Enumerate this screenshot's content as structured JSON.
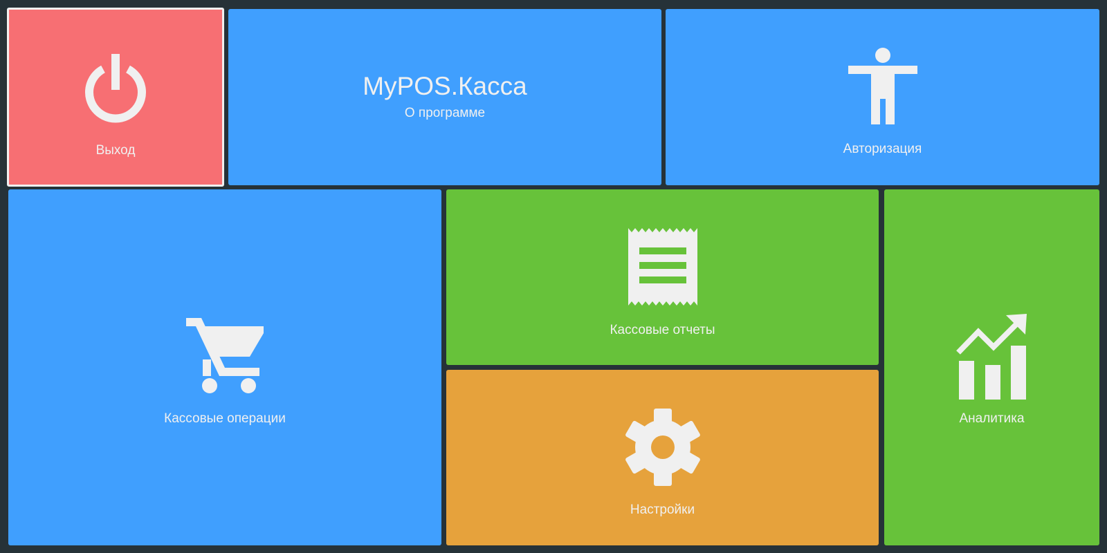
{
  "tiles": {
    "exit": {
      "label": "Выход",
      "icon": "power-icon",
      "color": "#f76f73"
    },
    "about": {
      "title": "MyPOS.Касса",
      "subtitle": "О программе",
      "color": "#409ffe"
    },
    "auth": {
      "label": "Авторизация",
      "icon": "person-icon",
      "color": "#409ffe"
    },
    "operations": {
      "label": "Кассовые операции",
      "icon": "cart-icon",
      "color": "#409ffe"
    },
    "reports": {
      "label": "Кассовые отчеты",
      "icon": "receipt-icon",
      "color": "#67c23a"
    },
    "settings": {
      "label": "Настройки",
      "icon": "gear-icon",
      "color": "#e6a23c"
    },
    "analytics": {
      "label": "Аналитика",
      "icon": "chart-growth-icon",
      "color": "#67c23a"
    }
  },
  "colors": {
    "background": "#263238",
    "tile_text": "#f0f0f0"
  }
}
